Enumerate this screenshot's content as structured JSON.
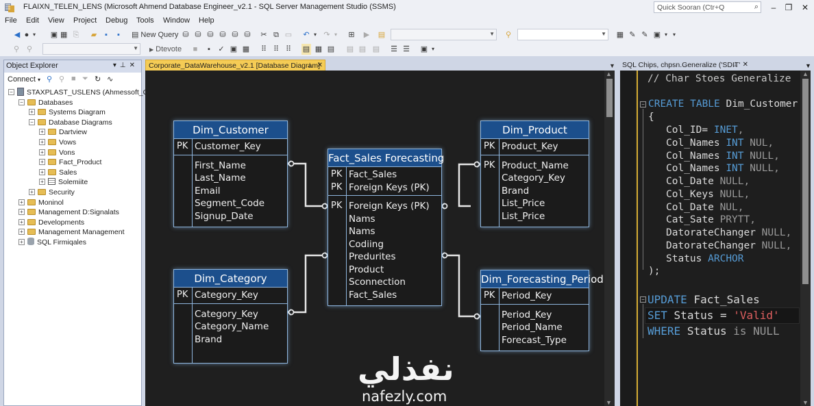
{
  "window": {
    "title": "FLAIXN_TELEN_LENS (Microsoft Ahmend Database Engineer_v2.1 - SQL Server Management Studio (SSMS)",
    "quick_search_placeholder": "Quick Sooran (Ctr+Q",
    "controls": [
      "–",
      "❐",
      "✕"
    ]
  },
  "menu": [
    "File",
    "Edit",
    "View",
    "Project",
    "Debug",
    "Tools",
    "Window",
    "Help"
  ],
  "toolbar1": {
    "new_query_label": "New Query"
  },
  "toolbar2": {
    "execute_label": "Dtevote"
  },
  "object_explorer": {
    "title": "Object Explorer",
    "connect_label": "Connect",
    "tree": [
      {
        "label": "STAXPLAST_USLENS (Ahmessoft_Con",
        "level": 0,
        "expander": "−",
        "icon": "server-icon"
      },
      {
        "label": "Databases",
        "level": 1,
        "expander": "−",
        "icon": "folder-icon"
      },
      {
        "label": "Systems Diagram",
        "level": 2,
        "expander": "+",
        "icon": "folder-icon"
      },
      {
        "label": "Database Diagrams",
        "level": 2,
        "expander": "−",
        "icon": "folder-icon"
      },
      {
        "label": "Dartview",
        "level": 3,
        "expander": "+",
        "icon": "folder-icon"
      },
      {
        "label": "Vows",
        "level": 3,
        "expander": "+",
        "icon": "folder-icon"
      },
      {
        "label": "Vons",
        "level": 3,
        "expander": "+",
        "icon": "folder-icon"
      },
      {
        "label": "Fact_Product",
        "level": 3,
        "expander": "+",
        "icon": "folder-icon"
      },
      {
        "label": "Sales",
        "level": 3,
        "expander": "+",
        "icon": "folder-icon"
      },
      {
        "label": "Solemiite",
        "level": 3,
        "expander": "+",
        "icon": "table-icon"
      },
      {
        "label": "Security",
        "level": 2,
        "expander": "+",
        "icon": "folder-icon"
      },
      {
        "label": "Moninol",
        "level": 1,
        "expander": "+",
        "icon": "folder-icon"
      },
      {
        "label": "Management D:Signalats",
        "level": 1,
        "expander": "+",
        "icon": "folder-icon"
      },
      {
        "label": "Developments",
        "level": 1,
        "expander": "+",
        "icon": "folder-icon"
      },
      {
        "label": "Management Management",
        "level": 1,
        "expander": "+",
        "icon": "folder-icon"
      },
      {
        "label": "SQL Firmiqales",
        "level": 1,
        "expander": "+",
        "icon": "database-icon"
      }
    ]
  },
  "diagram_tab": {
    "label": "Corporate_DataWarehouse_v2.1 [Database Diagram]"
  },
  "sql_tab": {
    "label": "SQL Chips, chpsn.Generalize ('SDIT'"
  },
  "entities": {
    "dim_customer": {
      "name": "Dim_Customer",
      "pk_rows": [
        {
          "pk": "PK",
          "name": "Customer_Key"
        }
      ],
      "rows": [
        {
          "pk": "",
          "name": "First_Name"
        },
        {
          "pk": "",
          "name": "Last_Name"
        },
        {
          "pk": "",
          "name": "Email"
        },
        {
          "pk": "",
          "name": "Segment_Code"
        },
        {
          "pk": "",
          "name": "Signup_Date"
        }
      ]
    },
    "fact_sales": {
      "name": "Fact_Sales Forecasting",
      "pk_rows": [
        {
          "pk": "PK",
          "name": "Fact_Sales"
        },
        {
          "pk": "PK",
          "name": "Foreign Keys (PK)"
        }
      ],
      "rows": [
        {
          "pk": "PK",
          "name": "Foreign Keys (PK)"
        },
        {
          "pk": "",
          "name": "Nams"
        },
        {
          "pk": "",
          "name": "Nams"
        },
        {
          "pk": "",
          "name": "Codiing"
        },
        {
          "pk": "",
          "name": "Predurites"
        },
        {
          "pk": "",
          "name": "Product"
        },
        {
          "pk": "",
          "name": "Sconnection"
        },
        {
          "pk": "",
          "name": "Fact_Sales"
        }
      ]
    },
    "dim_product": {
      "name": "Dim_Product",
      "pk_rows": [
        {
          "pk": "PK",
          "name": "Product_Key"
        }
      ],
      "rows": [
        {
          "pk": "PK",
          "name": "Product_Name"
        },
        {
          "pk": "",
          "name": "Category_Key"
        },
        {
          "pk": "",
          "name": "Brand"
        },
        {
          "pk": "",
          "name": "List_Price"
        },
        {
          "pk": "",
          "name": "List_Price"
        }
      ]
    },
    "dim_category": {
      "name": "Dim_Category",
      "pk_rows": [
        {
          "pk": "PK",
          "name": "Category_Key"
        }
      ],
      "rows": [
        {
          "pk": "",
          "name": "Category_Key"
        },
        {
          "pk": "",
          "name": "Category_Name"
        },
        {
          "pk": "",
          "name": "Brand"
        },
        {
          "pk": "",
          "name": ""
        }
      ]
    },
    "dim_period": {
      "name": "Dim_Forecasting_Period",
      "pk_rows": [
        {
          "pk": "PK",
          "name": "Period_Key"
        }
      ],
      "rows": [
        {
          "pk": "",
          "name": "Period_Key"
        },
        {
          "pk": "",
          "name": "Period_Name"
        },
        {
          "pk": "",
          "name": "Forecast_Type"
        }
      ]
    }
  },
  "watermark": {
    "arabic": "نفذلي",
    "latin": "nafezly.com"
  },
  "sql_editor": {
    "comment": "// Char Stoes Generalize",
    "create_kw": "CREATE TABLE",
    "create_name": "Dim_Customer",
    "open_paren": "{",
    "columns": [
      {
        "name": "Col_ID=",
        "type": "INET",
        "tail": ","
      },
      {
        "name": "Col_Names",
        "type": "INT",
        "tail": " NUL,"
      },
      {
        "name": "Col_Names",
        "type": "INT",
        "tail": " NULL,"
      },
      {
        "name": "Col_Names",
        "type": "INT",
        "tail": " NULL,"
      },
      {
        "name": "Col_Date",
        "type": "",
        "tail": " NULL,"
      },
      {
        "name": "Col_Keys",
        "type": "",
        "tail": " NULL,"
      },
      {
        "name": "Col_Date",
        "type": "",
        "tail": " NUL,"
      },
      {
        "name": "Cat_Sate",
        "type": "",
        "tail": " PRYTT,"
      },
      {
        "name": "DatorateChanger",
        "type": "",
        "tail": " NULL,"
      },
      {
        "name": "DatorateChanger",
        "type": "",
        "tail": " NULL,"
      },
      {
        "name": "Status",
        "type": "ARCHOR",
        "tail": ""
      }
    ],
    "close_paren": ");",
    "update_kw": "UPDATE",
    "update_table": "Fact_Sales",
    "set_kw": "SET",
    "set_expr": "Status =",
    "set_value": "'Valid'",
    "where_kw": "WHERE",
    "where_expr": "Status",
    "where_is": "is",
    "where_null": "NULL"
  },
  "colors": {
    "entity_header": "#1c4f8c",
    "entity_border": "#8fb6de",
    "diagram_bg": "#1f1f1f",
    "tab_active": "#f5cc55",
    "sql_keyword": "#569cd6",
    "sql_string": "#e06060"
  }
}
